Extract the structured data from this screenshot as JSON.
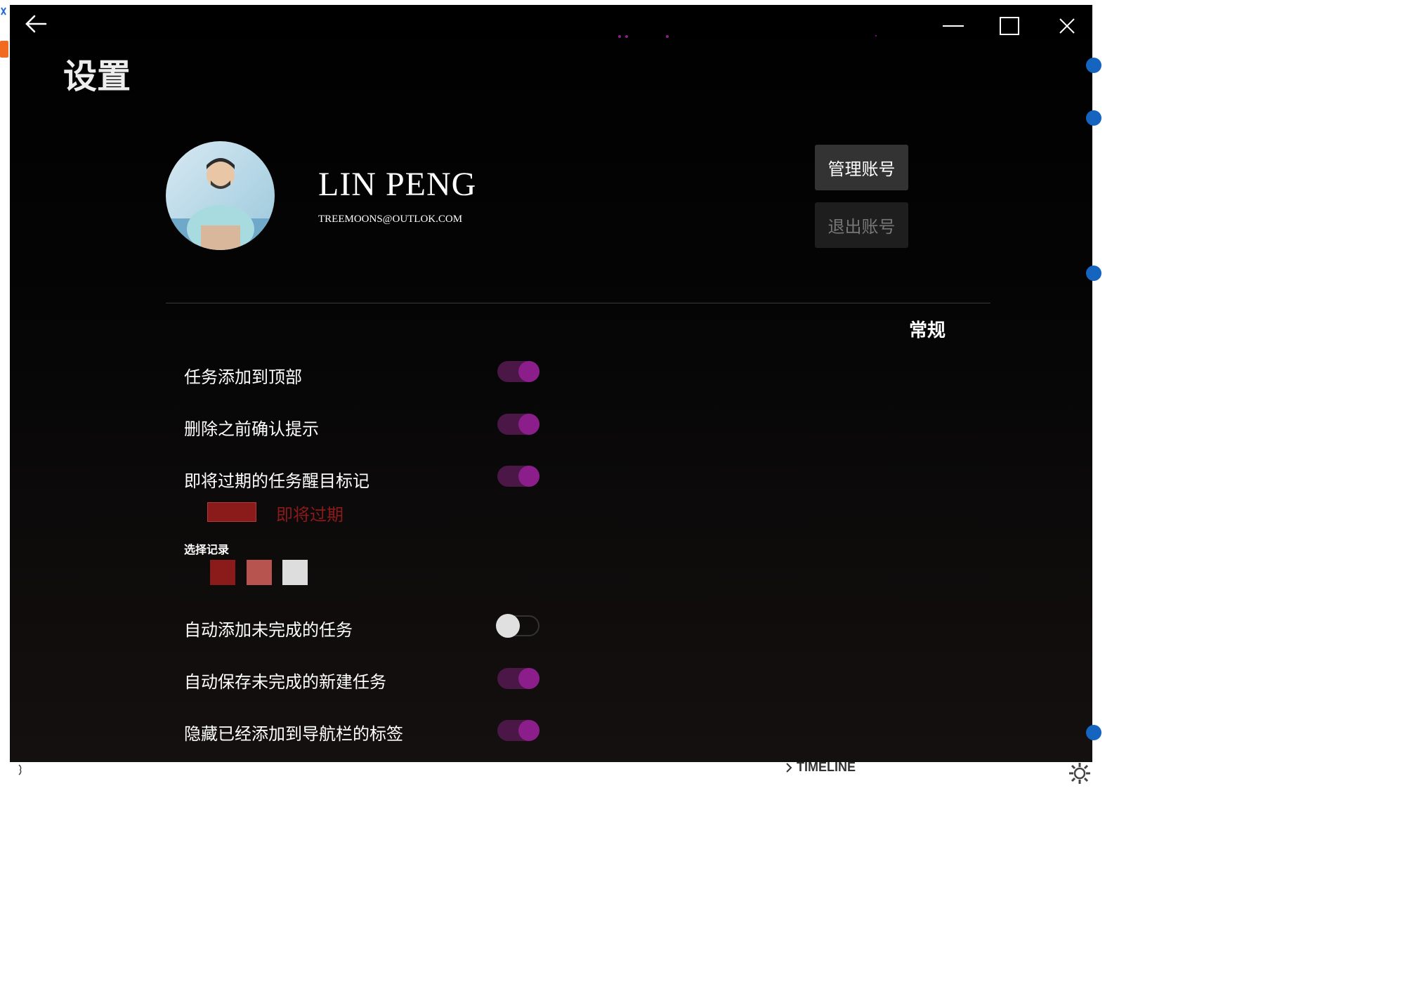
{
  "window": {
    "title": "设置",
    "back_icon": "arrow-left-icon",
    "minimize_icon": "minimize-icon",
    "maximize_icon": "maximize-icon",
    "close_icon": "close-icon"
  },
  "profile": {
    "name": "LIN PENG",
    "email": "TREEMOONS@OUTLOK.COM"
  },
  "buttons": {
    "manage_account": "管理账号",
    "logout": "退出账号"
  },
  "section_title": "常规",
  "settings": [
    {
      "label": "任务添加到顶部",
      "toggle": true
    },
    {
      "label": "删除之前确认提示",
      "toggle": true
    },
    {
      "label": "即将过期的任务醒目标记",
      "toggle": true,
      "extra": {
        "preview_color": "#8B1A1A",
        "color_label": "即将过期",
        "record_label": "选择记录",
        "swatches": [
          "#8B1A1A",
          "#B85450",
          "#DDDDDD"
        ]
      }
    },
    {
      "label": "自动添加未完成的任务",
      "toggle": false
    },
    {
      "label": "自动保存未完成的新建任务",
      "toggle": true
    },
    {
      "label": "隐藏已经添加到导航栏的标签",
      "toggle": true
    }
  ],
  "peripheral": {
    "timeline_label": "TIMELINE",
    "chevron_icon": "chevron-right-icon",
    "gear_icon": "gear-icon"
  },
  "colors": {
    "accent": "#8B1E8B",
    "toggle_on_track": "#4A1747",
    "toggle_off_knob": "#E0E0E0",
    "warning_text": "#8B1A1A"
  }
}
